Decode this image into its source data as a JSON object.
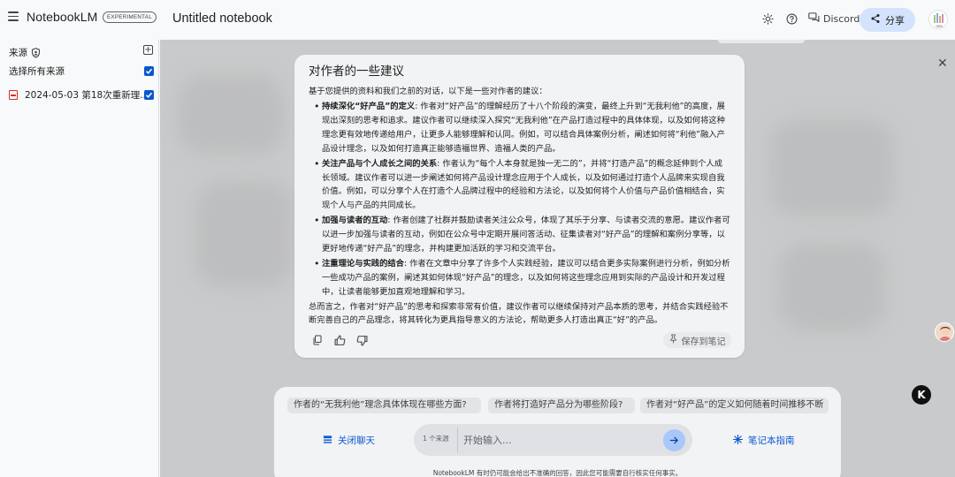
{
  "header": {
    "brand": "NotebookLM",
    "badge": "EXPERIMENTAL",
    "notebook_title": "Untitled notebook",
    "discord_label": "Discord",
    "share_label": "分享",
    "avatar_caption": "GEN"
  },
  "sidebar": {
    "sources_label": "来源",
    "select_all_label": "选择所有来源",
    "items": [
      {
        "label": "2024-05-03 第18次重新理...",
        "type": "pdf",
        "checked": true
      }
    ]
  },
  "card": {
    "title": "对作者的一些建议",
    "intro": "基于您提供的资料和我们之前的对话，以下是一些对作者的建议：",
    "points": [
      {
        "title": "持续深化“好产品”的定义",
        "text": ": 作者对“好产品”的理解经历了十八个阶段的演变，最终上升到“无我利他”的高度，展现出深刻的思考和追求。建议作者可以继续深入探究“无我利他”在产品打造过程中的具体体现，以及如何将这种理念更有效地传递给用户，让更多人能够理解和认同。例如，可以结合具体案例分析，阐述如何将“利他”融入产品设计理念，以及如何打造真正能够造福世界、造福人类的产品。"
      },
      {
        "title": "关注产品与个人成长之间的关系",
        "text": ": 作者认为“每个人本身就是独一无二的”，并将“打造产品”的概念延伸到个人成长领域。建议作者可以进一步阐述如何将产品设计理念应用于个人成长，以及如何通过打造个人品牌来实现自我价值。例如，可以分享个人在打造个人品牌过程中的经验和方法论，以及如何将个人价值与产品价值相结合，实现个人与产品的共同成长。"
      },
      {
        "title": "加强与读者的互动",
        "text": ": 作者创建了社群并鼓励读者关注公众号，体现了其乐于分享、与读者交流的意愿。建议作者可以进一步加强与读者的互动，例如在公众号中定期开展问答活动、征集读者对“好产品”的理解和案例分享等，以更好地传递“好产品”的理念，并构建更加活跃的学习和交流平台。"
      },
      {
        "title": "注重理论与实践的结合",
        "text": ": 作者在文章中分享了许多个人实践经验，建议可以结合更多实际案例进行分析，例如分析一些成功产品的案例，阐述其如何体现“好产品”的理念，以及如何将这些理念应用到实际的产品设计和开发过程中，让读者能够更加直观地理解和学习。"
      }
    ],
    "conclusion": "总而言之，作者对“好产品”的思考和探索非常有价值，建议作者可以继续保持对产品本质的思考，并结合实践经验不断完善自己的产品理念，将其转化为更具指导意义的方法论，帮助更多人打造出真正“好”的产品。",
    "save_note_label": "保存到笔记"
  },
  "bottom": {
    "suggestions": [
      "作者的“无我利他”理念具体体现在哪些方面?",
      "作者将打造好产品分为哪些阶段?",
      "作者对“好产品”的定义如何随着时间推移不断"
    ],
    "close_chat_label": "关闭聊天",
    "source_count": "1 个来源",
    "input_placeholder": "开始输入...",
    "notebook_guide_label": "笔记本指南",
    "disclaimer": "NotebookLM 有时仍可能会给出不准确的回答，因此您可能需要自行核实任何事实。"
  },
  "floating": {
    "k_badge": "K"
  },
  "colors": {
    "accent": "#0b57d0",
    "share_bg": "#d3e3fd",
    "send_bg": "#a8c7fa",
    "pdf_red": "#d93025"
  }
}
